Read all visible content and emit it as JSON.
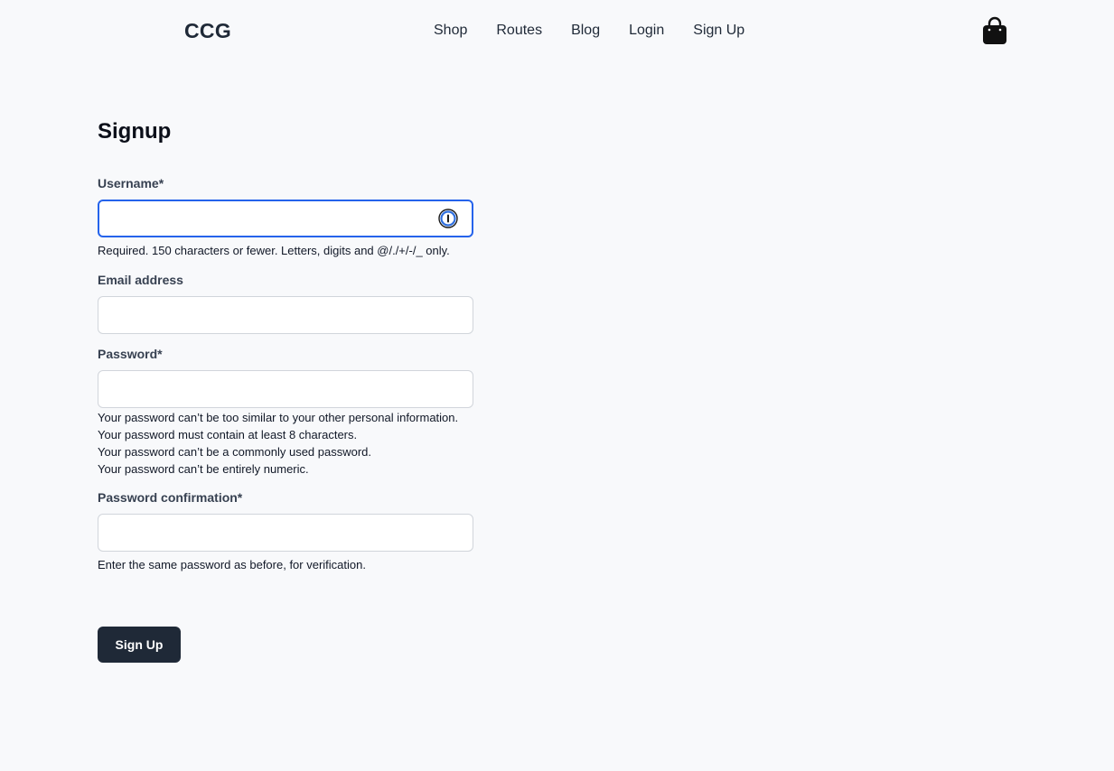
{
  "header": {
    "brand": "CCG",
    "nav": [
      {
        "label": "Shop"
      },
      {
        "label": "Routes"
      },
      {
        "label": "Blog"
      },
      {
        "label": "Login"
      },
      {
        "label": "Sign Up"
      }
    ],
    "cart_icon": "shopping-bag-icon"
  },
  "page": {
    "title": "Signup"
  },
  "form": {
    "username": {
      "label": "Username*",
      "value": "",
      "placeholder": "",
      "help": "Required. 150 characters or fewer. Letters, digits and @/./+/-/_ only.",
      "focused": true,
      "password_manager_icon": "password-manager-icon"
    },
    "email": {
      "label": "Email address",
      "value": "",
      "placeholder": ""
    },
    "password": {
      "label": "Password*",
      "value": "",
      "placeholder": "",
      "help": [
        "Your password can’t be too similar to your other personal information.",
        "Your password must contain at least 8 characters.",
        "Your password can’t be a commonly used password.",
        "Your password can’t be entirely numeric."
      ]
    },
    "password_confirmation": {
      "label": "Password confirmation*",
      "value": "",
      "placeholder": "",
      "help": "Enter the same password as before, for verification."
    },
    "submit_label": "Sign Up"
  },
  "colors": {
    "background": "#f8f9fb",
    "button": "#1f2937",
    "focus_ring": "#2563eb",
    "input_border": "#d1d5db"
  }
}
